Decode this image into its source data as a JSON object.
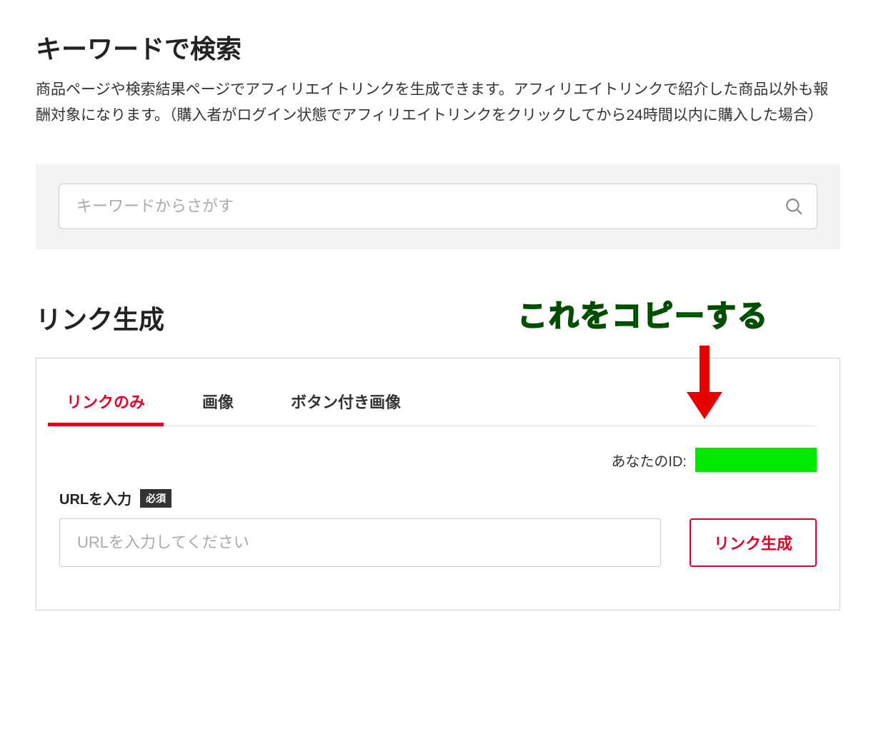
{
  "search_section": {
    "title": "キーワードで検索",
    "description": "商品ページや検索結果ページでアフィリエイトリンクを生成できます。アフィリエイトリンクで紹介した商品以外も報酬対象になります。（購入者がログイン状態でアフィリエイトリンクをクリックしてから24時間以内に購入した場合）",
    "placeholder": "キーワードからさがす"
  },
  "link_section": {
    "title": "リンク生成",
    "annotation": "これをコピーする",
    "tabs": {
      "link_only": "リンクのみ",
      "image": "画像",
      "button_image": "ボタン付き画像"
    },
    "id_label": "あなたのID:",
    "url_label": "URLを入力",
    "required_badge": "必須",
    "url_placeholder": "URLを入力してください",
    "generate_button": "リンク生成"
  }
}
